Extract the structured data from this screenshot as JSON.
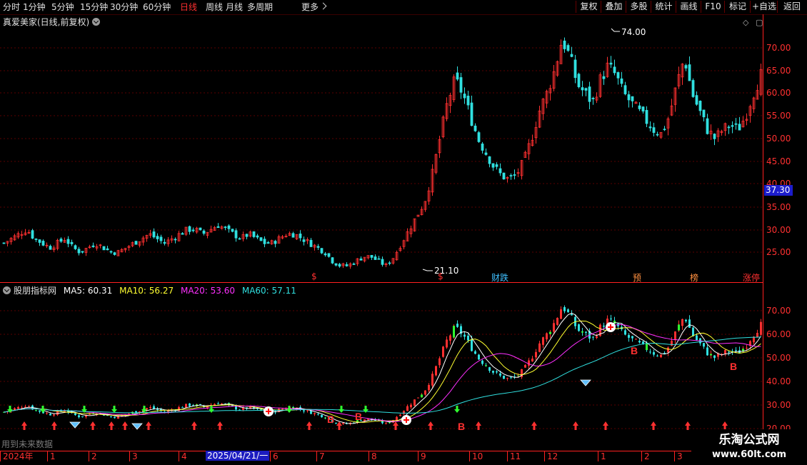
{
  "toolbar": {
    "periods": [
      {
        "label": "分时",
        "active": false
      },
      {
        "label": "1分钟",
        "active": false
      },
      {
        "label": "5分钟",
        "active": false
      },
      {
        "label": "15分钟",
        "active": false
      },
      {
        "label": "30分钟",
        "active": false
      },
      {
        "label": "60分钟",
        "active": false
      },
      {
        "label": "日线",
        "active": true
      },
      {
        "label": "周线",
        "active": false
      },
      {
        "label": "月线",
        "active": false
      },
      {
        "label": "多周期",
        "active": false
      }
    ],
    "more_label": "更多",
    "right_buttons": [
      "复权",
      "叠加",
      "多股",
      "统计",
      "画线",
      "F10",
      "标记",
      "+自选",
      "返回"
    ]
  },
  "main": {
    "title": "真爱美家(日线,前复权)",
    "y_labels": [
      "70.00",
      "65.00",
      "60.00",
      "55.00",
      "50.00",
      "45.00",
      "40.00",
      "35.00",
      "30.00",
      "25.00"
    ],
    "current_price": "37.30",
    "high_label": "74.00",
    "low_label": "21.10",
    "events": [
      {
        "label": "$",
        "color": "#ff3030"
      },
      {
        "label": "$",
        "color": "#ff3030"
      },
      {
        "label": "财跌",
        "color": "#40c0ff"
      },
      {
        "label": "预",
        "color": "#ff9040"
      },
      {
        "label": "榜",
        "color": "#ff9040"
      },
      {
        "label": "涨停",
        "color": "#ff3030"
      }
    ]
  },
  "indicator": {
    "name": "股朋指标网",
    "ma5": {
      "label": "MA5: 60.31",
      "color": "#ffffff"
    },
    "ma10": {
      "label": "MA10: 56.27",
      "color": "#ffff30"
    },
    "ma20": {
      "label": "MA20: 53.60",
      "color": "#ff30ff"
    },
    "ma60": {
      "label": "MA60: 57.11",
      "color": "#30e0e0"
    },
    "y_labels": [
      "70.00",
      "60.00",
      "50.00",
      "40.00",
      "30.00",
      "20.00"
    ]
  },
  "date_axis": {
    "labels": [
      "2024年",
      "1",
      "2",
      "3",
      "4",
      "2025/04/21/一",
      "6",
      "7",
      "8",
      "9",
      "10",
      "11",
      "12",
      "1",
      "2",
      "3"
    ]
  },
  "future_note": "用到未来数据",
  "watermark": {
    "line1": "乐淘公式网",
    "line2": "www.60lt.com"
  },
  "colors": {
    "up": "#ff3030",
    "down": "#30e0e0",
    "flat": "#ffffff",
    "grid": "#5a0000",
    "accent": "#ff2020"
  },
  "chart_data": {
    "type": "candlestick",
    "title": "真爱美家(日线,前复权)",
    "ylim": [
      20,
      76
    ],
    "x_periods": [
      "2024-12",
      "2025-01",
      "2025-02",
      "2025-03",
      "2025-04",
      "2025-05",
      "2025-06",
      "2025-07",
      "2025-08",
      "2025-09",
      "2025-10",
      "2025-11",
      "2025-12",
      "2026-01",
      "2026-02",
      "2026-03"
    ],
    "close_path": [
      27,
      28,
      29,
      30,
      28,
      27,
      26,
      27,
      28,
      26,
      25,
      26,
      27,
      26,
      25,
      25,
      26,
      27,
      28,
      29,
      28,
      27,
      28,
      29,
      30,
      30,
      29,
      30,
      31,
      30,
      29,
      28,
      29,
      28,
      27,
      27,
      28,
      29,
      29,
      28,
      27,
      26,
      25,
      23,
      22,
      22,
      23,
      24,
      24,
      23,
      22,
      24,
      27,
      30,
      33,
      36,
      42,
      50,
      58,
      63,
      60,
      55,
      50,
      47,
      44,
      42,
      41,
      42,
      45,
      50,
      56,
      60,
      65,
      72,
      68,
      62,
      60,
      58,
      63,
      66,
      64,
      60,
      58,
      56,
      54,
      52,
      51,
      55,
      62,
      68,
      60,
      56,
      52,
      50,
      52,
      53,
      52,
      55,
      60,
      64
    ],
    "high": 74.0,
    "low": 21.1,
    "last": 37.3
  }
}
